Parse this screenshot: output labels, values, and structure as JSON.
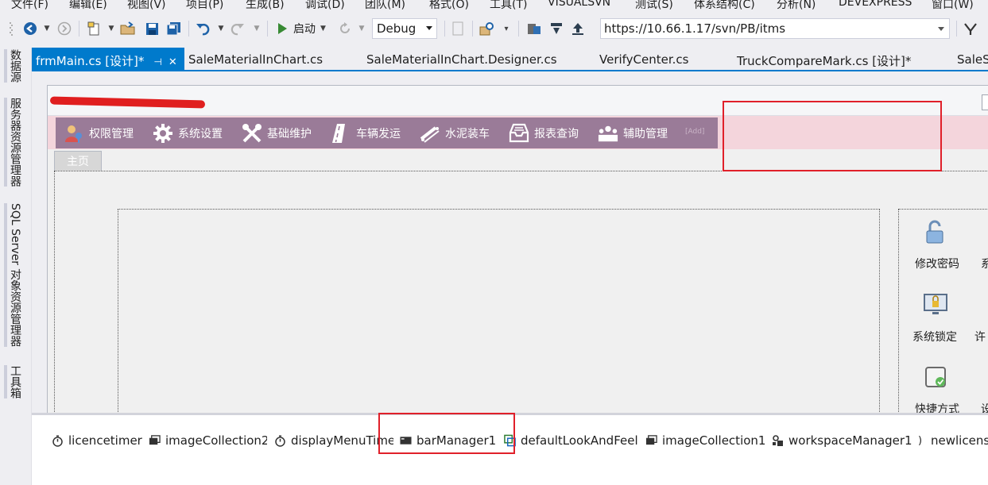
{
  "menu": [
    "文件(F)",
    "编辑(E)",
    "视图(V)",
    "项目(P)",
    "生成(B)",
    "调试(D)",
    "团队(M)",
    "格式(O)",
    "工具(T)",
    "VISUALSVN",
    "测试(S)",
    "体系结构(C)",
    "分析(N)",
    "DEVEXPRESS",
    "窗口(W)"
  ],
  "toolbar": {
    "start_label": "启动",
    "config": "Debug",
    "url": "https://10.66.1.17/svn/PB/itms"
  },
  "left_strip": [
    "数据源",
    "服务器资源管理器",
    "SQL Server 对象资源管理器",
    "工具箱"
  ],
  "tabs": [
    {
      "label": "frmMain.cs [设计]*"
    },
    {
      "label": "SaleMaterialInChart.cs"
    },
    {
      "label": "SaleMaterialInChart.Designer.cs"
    },
    {
      "label": "VerifyCenter.cs"
    },
    {
      "label": "TruckCompareMark.cs [设计]*"
    },
    {
      "label": "SaleS"
    }
  ],
  "ribbon": {
    "items": [
      {
        "label": "权限管理",
        "icon": "users-key-icon"
      },
      {
        "label": "系统设置",
        "icon": "gear-icon"
      },
      {
        "label": "基础维护",
        "icon": "tools-icon"
      },
      {
        "label": "车辆发运",
        "icon": "road-icon"
      },
      {
        "label": "水泥装车",
        "icon": "conveyor-icon"
      },
      {
        "label": "报表查询",
        "icon": "inbox-report-icon"
      },
      {
        "label": "辅助管理",
        "icon": "group-icon"
      }
    ],
    "add_label": "[Add]"
  },
  "home_tab": "主页",
  "side_panel": [
    {
      "label": "修改密码",
      "icon": "padlock-open-icon"
    },
    {
      "label": "系统锁定",
      "icon": "monitor-lock-icon"
    },
    {
      "label": "快捷方式",
      "icon": "shortcut-check-icon"
    }
  ],
  "side_panel_cut": [
    "系",
    "许",
    "设"
  ],
  "components": [
    {
      "label": "licencetimer",
      "icon": "timer-icon"
    },
    {
      "label": "imageCollection2",
      "icon": "image-collection-icon"
    },
    {
      "label": "displayMenuTimer",
      "icon": "timer-icon"
    },
    {
      "label": "barManager1",
      "icon": "bar-manager-icon"
    },
    {
      "label": "defaultLookAndFeel",
      "icon": "look-and-feel-icon"
    },
    {
      "label": "imageCollection1",
      "icon": "image-collection-icon"
    },
    {
      "label": "workspaceManager1",
      "icon": "workspace-icon"
    },
    {
      "label": "newlicense",
      "icon": "component-icon"
    }
  ],
  "colors": {
    "accent": "#007acc",
    "ribbon": "#9a7b98",
    "ribbon_area": "#f4d5dc",
    "highlight": "#e0202a"
  }
}
